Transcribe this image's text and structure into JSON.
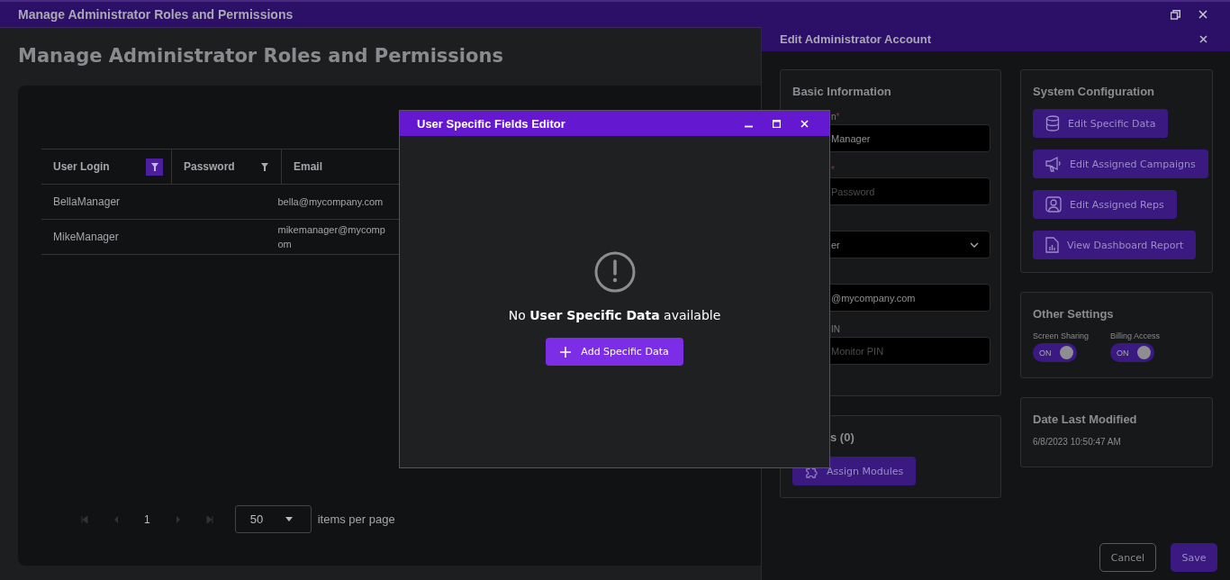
{
  "window": {
    "title": "Manage Administrator Roles and Permissions"
  },
  "page_title": "Manage Administrator Roles and Permissions",
  "table": {
    "columns": [
      {
        "label": "User Login",
        "filter_active": true
      },
      {
        "label": "Password",
        "filter_active": false
      },
      {
        "label": "Email"
      }
    ],
    "rows": [
      {
        "user_login": "BellaManager",
        "email": [
          "bella@mycompany.com"
        ]
      },
      {
        "user_login": "MikeManager",
        "email": [
          "mikemanager@mycomp",
          "om"
        ]
      }
    ]
  },
  "pagination": {
    "page": "1",
    "page_size": "50",
    "page_size_label": "items per page"
  },
  "edit_panel": {
    "title": "Edit Administrator Account",
    "basic_information": {
      "title": "Basic Information",
      "fields": [
        {
          "kind": "text",
          "label": "n",
          "mark": "*",
          "value": "Manager"
        },
        {
          "kind": "text",
          "mark": "*",
          "placeholder": "Password"
        },
        {
          "kind": "select",
          "value": "er"
        },
        {
          "kind": "text",
          "value": "@mycompany.com"
        },
        {
          "kind": "text",
          "label": "IN",
          "placeholder": "Monitor PIN"
        }
      ]
    },
    "modules": {
      "title": "s (0)",
      "button": "Assign Modules"
    },
    "system_configuration": {
      "title": "System Configuration",
      "buttons": [
        {
          "kind": "database",
          "label": "Edit Specific Data"
        },
        {
          "kind": "megaphone",
          "label": "Edit Assigned Campaigns"
        },
        {
          "kind": "person",
          "label": "Edit Assigned Reps"
        },
        {
          "kind": "report",
          "label": "View Dashboard Report"
        }
      ]
    },
    "other_settings": {
      "title": "Other Settings",
      "toggles": [
        {
          "label": "Screen Sharing",
          "on": true,
          "state_text": "ON"
        },
        {
          "label": "Billing Access",
          "on": true,
          "state_text": "ON"
        }
      ]
    },
    "date_last_modified": {
      "title": "Date Last Modified",
      "value": "6/8/2023 10:50:47 AM"
    },
    "buttons": {
      "cancel": "Cancel",
      "save": "Save"
    }
  },
  "modal": {
    "title": "User Specific Fields Editor",
    "message": "No **User Specific Data** available",
    "button": "Add Specific Data"
  }
}
